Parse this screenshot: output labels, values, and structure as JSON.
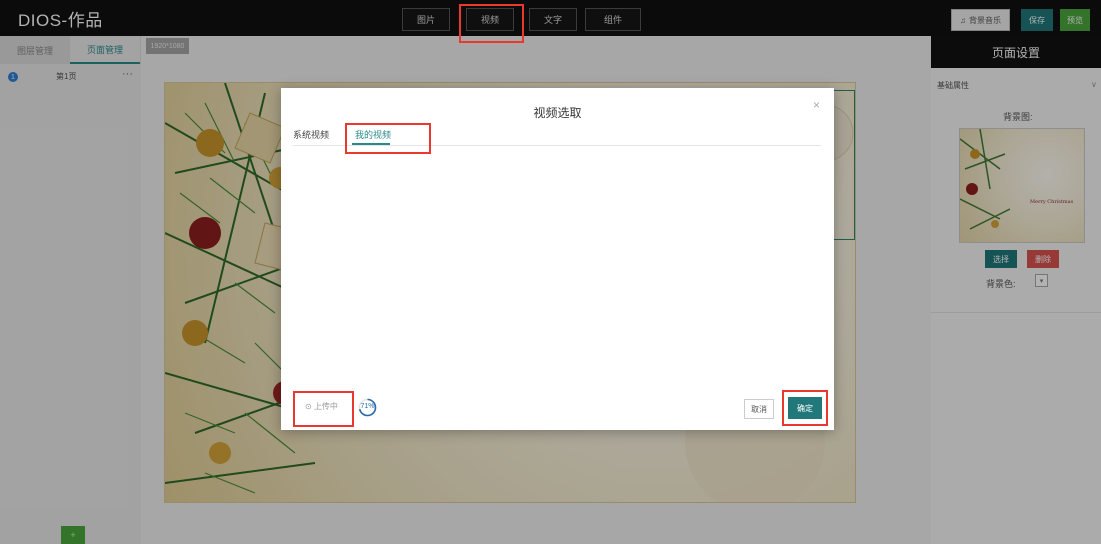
{
  "app": {
    "title": "DIOS-作品"
  },
  "toolbar": {
    "tabs": [
      {
        "label": "图片"
      },
      {
        "label": "视频"
      },
      {
        "label": "文字"
      },
      {
        "label": "组件"
      }
    ],
    "music_label": "背景音乐",
    "save_label": "保存",
    "preview_label": "预览"
  },
  "left_panel": {
    "tabs": [
      {
        "label": "图层管理",
        "active": false
      },
      {
        "label": "页面管理",
        "active": true
      }
    ],
    "pages": [
      {
        "number": "1",
        "label": "第1页",
        "more": "···"
      }
    ],
    "add_label": "+"
  },
  "canvas": {
    "size_label": "1920*1080"
  },
  "right_panel": {
    "header": "页面设置",
    "section": "基础属性",
    "bg_image_label": "背景图:",
    "thumb_text": "Merry Christmas",
    "select_label": "选择",
    "delete_label": "删除",
    "bg_color_label": "背景色:"
  },
  "modal": {
    "title": "视频选取",
    "close": "×",
    "tabs": [
      {
        "label": "系统视频",
        "active": false
      },
      {
        "label": "我的视频",
        "active": true
      }
    ],
    "upload_status": "上传中",
    "progress": 0.71,
    "progress_label": "71%",
    "cancel_label": "取消",
    "confirm_label": "确定"
  },
  "colors": {
    "accent": "#20787a",
    "highlight": "#e8382f",
    "preview": "#4aa63d",
    "delete": "#d9534f"
  }
}
